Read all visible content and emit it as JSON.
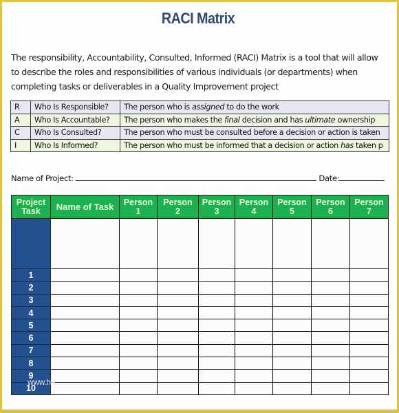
{
  "document": {
    "title": "RACI Matrix",
    "intro_lines": [
      "The responsibility, Accountability, Consulted, Informed (RACI) Matrix is a tool that will allow",
      "to describe the roles and responsibilities of various individuals (or departments) when",
      "completing tasks or deliverables in a Quality Improvement project"
    ]
  },
  "raci_legend": [
    {
      "letter": "R",
      "question": "Who Is Responsible?",
      "desc_parts": [
        {
          "text": "The person who is ",
          "italic": false
        },
        {
          "text": "assigned",
          "italic": true
        },
        {
          "text": " to do the work",
          "italic": false
        }
      ],
      "row_color": "#E8E6F2"
    },
    {
      "letter": "A",
      "question": "Who Is Accountable?",
      "desc_parts": [
        {
          "text": "The person who makes the ",
          "italic": false
        },
        {
          "text": "final",
          "italic": true
        },
        {
          "text": " decision and has ",
          "italic": false
        },
        {
          "text": "ultimate",
          "italic": true
        },
        {
          "text": " ownership",
          "italic": false
        }
      ],
      "row_color": "#EEF5E0"
    },
    {
      "letter": "C",
      "question": "Who Is Consulted?",
      "desc_parts": [
        {
          "text": "The person who must be consulted before a decision or action is taken",
          "italic": false
        }
      ],
      "row_color": "#E8E6F2"
    },
    {
      "letter": "I",
      "question": "Who Is Informed?",
      "desc_parts": [
        {
          "text": "The person who must be informed that a decision or action ",
          "italic": false
        },
        {
          "text": "has",
          "italic": true
        },
        {
          "text": " taken p",
          "italic": false
        }
      ],
      "row_color": "#EEF5E0"
    }
  ],
  "project_line": {
    "project_label": "Name of Project:",
    "project_value": "",
    "date_label": "Date:",
    "date_value": ""
  },
  "matrix": {
    "headers": {
      "project_task": [
        "Project",
        "Task"
      ],
      "task_name": "Name of Task",
      "persons": [
        [
          "Person",
          "1"
        ],
        [
          "Person",
          "2"
        ],
        [
          "Person",
          "3"
        ],
        [
          "Person",
          "4"
        ],
        [
          "Person",
          "5"
        ],
        [
          "Person",
          "6"
        ],
        [
          "Person",
          "7"
        ]
      ]
    },
    "header_color": "#1DB250",
    "number_column_color": "#24518F",
    "rows": [
      "",
      "1",
      "2",
      "3",
      "4",
      "5",
      "6",
      "7",
      "8",
      "9",
      "10"
    ]
  },
  "watermark": "www.he"
}
